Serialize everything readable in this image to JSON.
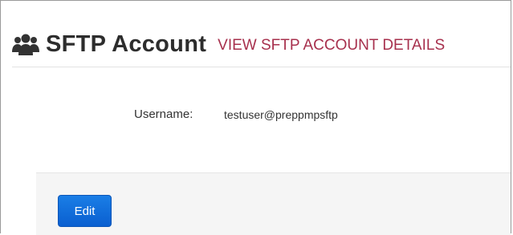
{
  "header": {
    "icon": "users-icon",
    "title": "SFTP Account",
    "subtitle": "VIEW SFTP ACCOUNT DETAILS"
  },
  "details": {
    "username_label": "Username:",
    "username_value": "testuser@preppmpsftp"
  },
  "actions": {
    "edit_label": "Edit"
  },
  "colors": {
    "title": "#2d2d2d",
    "subtitle": "#a7304d",
    "button": "#0a68d8",
    "panel": "#f5f5f5"
  }
}
